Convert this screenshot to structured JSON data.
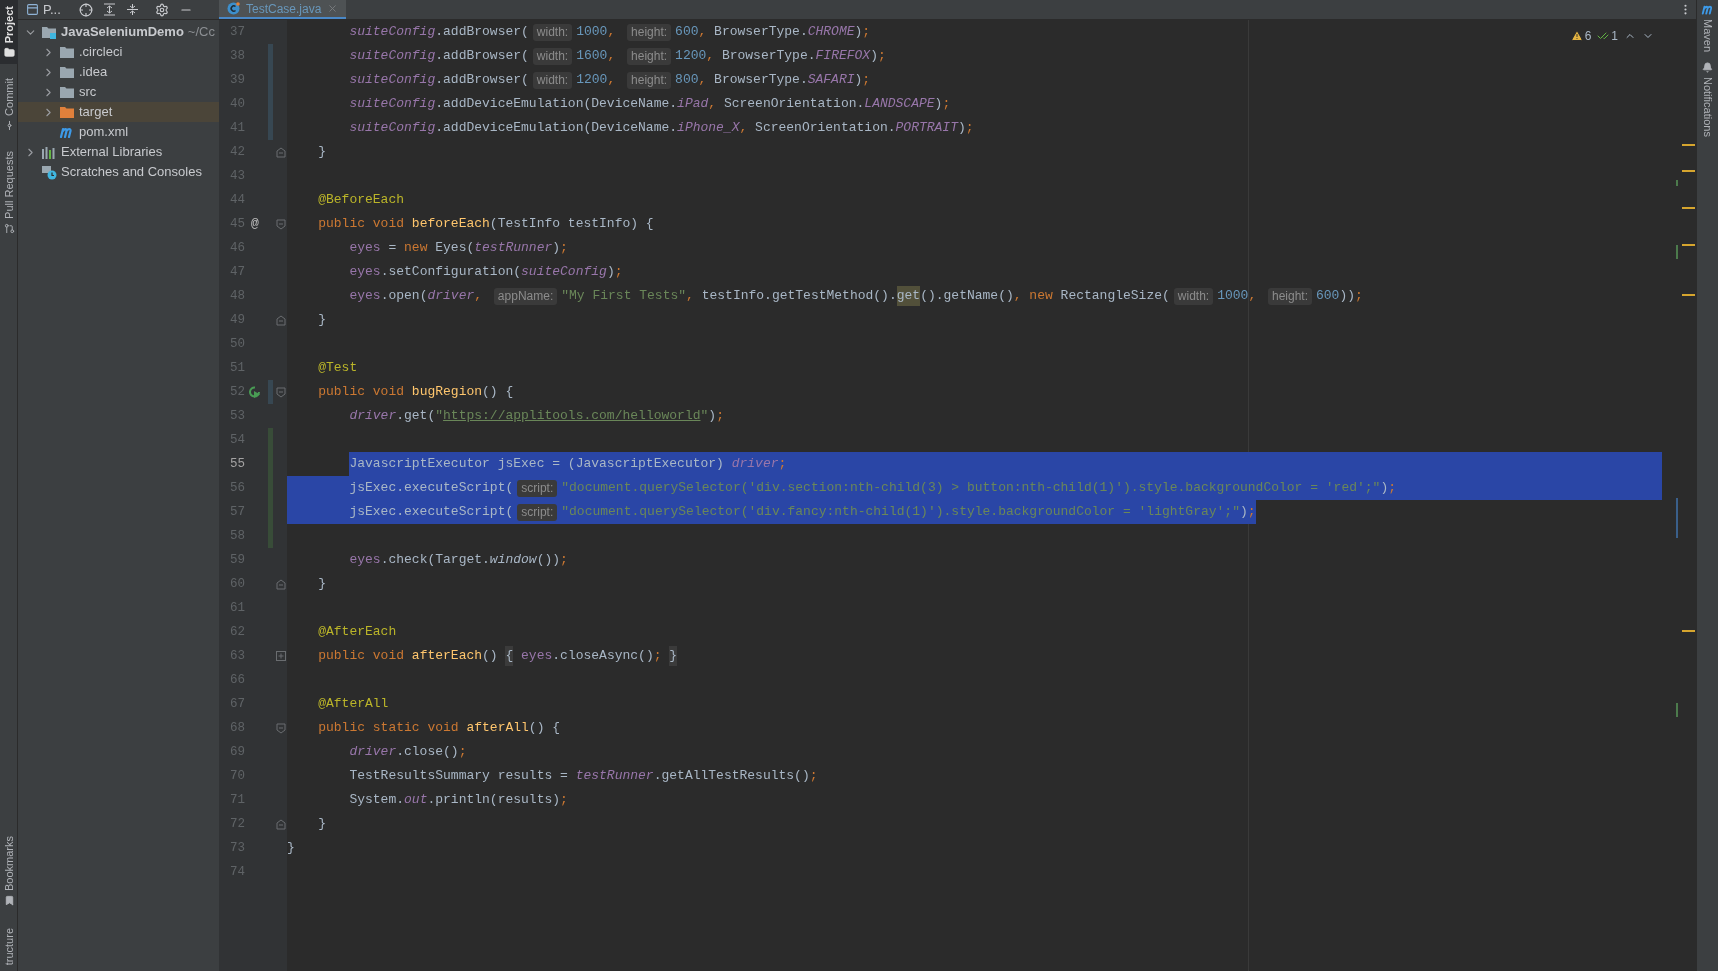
{
  "left_toolbar": {
    "top": [
      {
        "label": "Project",
        "kind": "folder",
        "selected": true
      },
      {
        "label": "Commit",
        "kind": "commit",
        "selected": false
      },
      {
        "label": "Pull Requests",
        "kind": "pull",
        "selected": false
      }
    ],
    "bottom": [
      {
        "label": "Bookmarks",
        "kind": "bookmark",
        "selected": false
      },
      {
        "label": "tructure",
        "kind": "plain",
        "selected": false
      }
    ]
  },
  "project_toolbar": {
    "label": "P..."
  },
  "tabs": [
    {
      "label": "TestCase.java",
      "selected": true
    }
  ],
  "project_tree": [
    {
      "label": "JavaSeleniumDemo",
      "suffix": "~/Cc",
      "kind": "module",
      "expanded": true,
      "selected": false,
      "children": [
        {
          "label": ".circleci",
          "kind": "folder",
          "expanded": false,
          "selected": false
        },
        {
          "label": ".idea",
          "kind": "folder",
          "expanded": false,
          "selected": false
        },
        {
          "label": "src",
          "kind": "folder",
          "expanded": false,
          "selected": false
        },
        {
          "label": "target",
          "kind": "excluded",
          "expanded": false,
          "selected": true
        },
        {
          "label": "pom.xml",
          "kind": "maven",
          "selected": false
        }
      ]
    },
    {
      "label": "External Libraries",
      "kind": "libraries",
      "expanded": false,
      "selected": false
    },
    {
      "label": "Scratches and Consoles",
      "kind": "scratches",
      "selected": false
    }
  ],
  "inspections": {
    "warnings": "6",
    "checks": "1"
  },
  "right_toolbar": [
    {
      "label": "Maven",
      "kind": "maven"
    },
    {
      "label": "Notifications",
      "kind": "bell"
    }
  ],
  "editor": {
    "lines": [
      {
        "number": "37",
        "current": false,
        "tokens": [
          {
            "kind": "field",
            "text": "        suiteConfig"
          },
          {
            "kind": "plain",
            "text": ".addBrowser("
          },
          {
            "kind": "hint",
            "text": "width:"
          },
          {
            "kind": "num",
            "text": "1000"
          },
          {
            "kind": "punct",
            "text": ", "
          },
          {
            "kind": "hint",
            "text": "height:"
          },
          {
            "kind": "num",
            "text": "600"
          },
          {
            "kind": "punct",
            "text": ", "
          },
          {
            "kind": "plain",
            "text": "BrowserType."
          },
          {
            "kind": "field",
            "text": "CHROME"
          },
          {
            "kind": "plain",
            "text": ")"
          },
          {
            "kind": "punct",
            "text": ";"
          }
        ]
      },
      {
        "number": "38",
        "current": false,
        "change": {
          "kind": "modified"
        },
        "tokens": [
          {
            "kind": "field",
            "text": "        suiteConfig"
          },
          {
            "kind": "plain",
            "text": ".addBrowser("
          },
          {
            "kind": "hint",
            "text": "width:"
          },
          {
            "kind": "num",
            "text": "1600"
          },
          {
            "kind": "punct",
            "text": ", "
          },
          {
            "kind": "hint",
            "text": "height:"
          },
          {
            "kind": "num",
            "text": "1200"
          },
          {
            "kind": "punct",
            "text": ", "
          },
          {
            "kind": "plain",
            "text": "BrowserType."
          },
          {
            "kind": "field",
            "text": "FIREFOX"
          },
          {
            "kind": "plain",
            "text": ")"
          },
          {
            "kind": "punct",
            "text": ";"
          }
        ]
      },
      {
        "number": "39",
        "current": false,
        "change": {
          "kind": "modified"
        },
        "tokens": [
          {
            "kind": "field",
            "text": "        suiteConfig"
          },
          {
            "kind": "plain",
            "text": ".addBrowser("
          },
          {
            "kind": "hint",
            "text": "width:"
          },
          {
            "kind": "num",
            "text": "1200"
          },
          {
            "kind": "punct",
            "text": ", "
          },
          {
            "kind": "hint",
            "text": "height:"
          },
          {
            "kind": "num",
            "text": "800"
          },
          {
            "kind": "punct",
            "text": ", "
          },
          {
            "kind": "plain",
            "text": "BrowserType."
          },
          {
            "kind": "field",
            "text": "SAFARI"
          },
          {
            "kind": "plain",
            "text": ")"
          },
          {
            "kind": "punct",
            "text": ";"
          }
        ]
      },
      {
        "number": "40",
        "current": false,
        "change": {
          "kind": "modified"
        },
        "tokens": [
          {
            "kind": "field",
            "text": "        suiteConfig"
          },
          {
            "kind": "plain",
            "text": ".addDeviceEmulation(DeviceName."
          },
          {
            "kind": "field",
            "text": "iPad"
          },
          {
            "kind": "punct",
            "text": ", "
          },
          {
            "kind": "plain",
            "text": "ScreenOrientation."
          },
          {
            "kind": "field",
            "text": "LANDSCAPE"
          },
          {
            "kind": "plain",
            "text": ")"
          },
          {
            "kind": "punct",
            "text": ";"
          }
        ]
      },
      {
        "number": "41",
        "current": false,
        "change": {
          "kind": "modified"
        },
        "tokens": [
          {
            "kind": "field",
            "text": "        suiteConfig"
          },
          {
            "kind": "plain",
            "text": ".addDeviceEmulation(DeviceName."
          },
          {
            "kind": "field",
            "text": "iPhone_X"
          },
          {
            "kind": "punct",
            "text": ", "
          },
          {
            "kind": "plain",
            "text": "ScreenOrientation."
          },
          {
            "kind": "field",
            "text": "PORTRAIT"
          },
          {
            "kind": "plain",
            "text": ")"
          },
          {
            "kind": "punct",
            "text": ";"
          }
        ]
      },
      {
        "number": "42",
        "current": false,
        "fold": {
          "kind": "end"
        },
        "tokens": [
          {
            "kind": "plain",
            "text": "    }"
          }
        ]
      },
      {
        "number": "43",
        "current": false
      },
      {
        "number": "44",
        "current": false,
        "tokens": [
          {
            "kind": "ann",
            "text": "    @BeforeEach"
          }
        ]
      },
      {
        "number": "45",
        "current": false,
        "fold": {
          "kind": "start"
        },
        "gutter": {
          "kind": "text",
          "text": "@"
        },
        "tokens": [
          {
            "kind": "kw",
            "text": "    public void "
          },
          {
            "kind": "fn",
            "text": "beforeEach"
          },
          {
            "kind": "plain",
            "text": "(TestInfo testInfo) {"
          }
        ]
      },
      {
        "number": "46",
        "current": false,
        "tokens": [
          {
            "kind": "member",
            "text": "        eyes"
          },
          {
            "kind": "plain",
            "text": " = "
          },
          {
            "kind": "kw",
            "text": "new "
          },
          {
            "kind": "plain",
            "text": "Eyes("
          },
          {
            "kind": "field",
            "text": "testRunner"
          },
          {
            "kind": "plain",
            "text": ")"
          },
          {
            "kind": "punct",
            "text": ";"
          }
        ]
      },
      {
        "number": "47",
        "current": false,
        "tokens": [
          {
            "kind": "member",
            "text": "        eyes"
          },
          {
            "kind": "plain",
            "text": ".setConfiguration("
          },
          {
            "kind": "field",
            "text": "suiteConfig"
          },
          {
            "kind": "plain",
            "text": ")"
          },
          {
            "kind": "punct",
            "text": ";"
          }
        ]
      },
      {
        "number": "48",
        "current": false,
        "tokens": [
          {
            "kind": "member",
            "text": "        eyes"
          },
          {
            "kind": "plain",
            "text": ".open("
          },
          {
            "kind": "field",
            "text": "driver"
          },
          {
            "kind": "punct",
            "text": ", "
          },
          {
            "kind": "hint",
            "text": "appName:"
          },
          {
            "kind": "str",
            "text": "\"My First Tests\""
          },
          {
            "kind": "punct",
            "text": ", "
          },
          {
            "kind": "plain",
            "text": "testInfo.getTestMethod()."
          },
          {
            "kind": "match",
            "text": "get"
          },
          {
            "kind": "plain",
            "text": "().getName()"
          },
          {
            "kind": "punct",
            "text": ", "
          },
          {
            "kind": "kw",
            "text": "new "
          },
          {
            "kind": "plain",
            "text": "RectangleSize("
          },
          {
            "kind": "hint",
            "text": "width:"
          },
          {
            "kind": "num",
            "text": "1000"
          },
          {
            "kind": "punct",
            "text": ", "
          },
          {
            "kind": "hint",
            "text": "height:"
          },
          {
            "kind": "num",
            "text": "600"
          },
          {
            "kind": "plain",
            "text": "))"
          },
          {
            "kind": "punct",
            "text": ";"
          }
        ]
      },
      {
        "number": "49",
        "current": false,
        "fold": {
          "kind": "end"
        },
        "tokens": [
          {
            "kind": "plain",
            "text": "    }"
          }
        ]
      },
      {
        "number": "50",
        "current": false
      },
      {
        "number": "51",
        "current": false,
        "tokens": [
          {
            "kind": "ann",
            "text": "    @Test"
          }
        ]
      },
      {
        "number": "52",
        "current": false,
        "fold": {
          "kind": "start"
        },
        "change": {
          "kind": "modified"
        },
        "gutter": {
          "kind": "run"
        },
        "tokens": [
          {
            "kind": "kw",
            "text": "    public void "
          },
          {
            "kind": "fn",
            "text": "bugRegion"
          },
          {
            "kind": "plain",
            "text": "() {"
          }
        ]
      },
      {
        "number": "53",
        "current": false,
        "tokens": [
          {
            "kind": "field",
            "text": "        driver"
          },
          {
            "kind": "plain",
            "text": ".get("
          },
          {
            "kind": "str",
            "text": "\""
          },
          {
            "kind": "url",
            "text": "https://applitools.com/helloworld"
          },
          {
            "kind": "str",
            "text": "\""
          },
          {
            "kind": "plain",
            "text": ")"
          },
          {
            "kind": "punct",
            "text": ";"
          }
        ]
      },
      {
        "number": "54",
        "current": false,
        "change": {
          "kind": "added"
        }
      },
      {
        "number": "55",
        "current": true,
        "change": {
          "kind": "added"
        },
        "selection": {
          "kind": "from_text"
        },
        "tokens": [
          {
            "kind": "plain",
            "text": "        JavascriptExecutor jsExec = (JavascriptExecutor) "
          },
          {
            "kind": "field",
            "text": "driver"
          },
          {
            "kind": "punct",
            "text": ";"
          }
        ]
      },
      {
        "number": "56",
        "current": false,
        "change": {
          "kind": "added"
        },
        "selection": {
          "kind": "full"
        },
        "tokens": [
          {
            "kind": "plain",
            "text": "        jsExec.executeScript("
          },
          {
            "kind": "hint",
            "text": "script:"
          },
          {
            "kind": "str",
            "text": "\"document.querySelector('div.section:nth-child(3) > button:nth-child(1)').style.backgroundColor = 'red';\""
          },
          {
            "kind": "plain",
            "text": ")"
          },
          {
            "kind": "punct",
            "text": ";"
          }
        ]
      },
      {
        "number": "57",
        "current": false,
        "change": {
          "kind": "added"
        },
        "selection": {
          "kind": "to_text"
        },
        "tokens": [
          {
            "kind": "plain",
            "text": "        jsExec.executeScript("
          },
          {
            "kind": "hint",
            "text": "script:"
          },
          {
            "kind": "str",
            "text": "\"document.querySelector('div.fancy:nth-child(1)').style.backgroundColor = 'lightGray';\""
          },
          {
            "kind": "plain",
            "text": ")"
          },
          {
            "kind": "punct",
            "text": ";"
          }
        ]
      },
      {
        "number": "58",
        "current": false,
        "change": {
          "kind": "added"
        }
      },
      {
        "number": "59",
        "current": false,
        "tokens": [
          {
            "kind": "member",
            "text": "        eyes"
          },
          {
            "kind": "plain",
            "text": ".check(Target."
          },
          {
            "kind": "italic",
            "text": "window"
          },
          {
            "kind": "plain",
            "text": "())"
          },
          {
            "kind": "punct",
            "text": ";"
          }
        ]
      },
      {
        "number": "60",
        "current": false,
        "fold": {
          "kind": "end"
        },
        "tokens": [
          {
            "kind": "plain",
            "text": "    }"
          }
        ]
      },
      {
        "number": "61",
        "current": false
      },
      {
        "number": "62",
        "current": false,
        "tokens": [
          {
            "kind": "ann",
            "text": "    @AfterEach"
          }
        ]
      },
      {
        "number": "63",
        "current": false,
        "fold": {
          "kind": "collapsed"
        },
        "tokens": [
          {
            "kind": "kw",
            "text": "    public void "
          },
          {
            "kind": "fn",
            "text": "afterEach"
          },
          {
            "kind": "plain",
            "text": "() "
          },
          {
            "kind": "folded",
            "text": "{"
          },
          {
            "kind": "member",
            "text": " eyes"
          },
          {
            "kind": "plain",
            "text": ".closeAsync()"
          },
          {
            "kind": "punct",
            "text": "; "
          },
          {
            "kind": "folded",
            "text": "}"
          }
        ]
      },
      {
        "number": "66",
        "current": false
      },
      {
        "number": "67",
        "current": false,
        "tokens": [
          {
            "kind": "ann",
            "text": "    @AfterAll"
          }
        ]
      },
      {
        "number": "68",
        "current": false,
        "fold": {
          "kind": "start"
        },
        "tokens": [
          {
            "kind": "kw",
            "text": "    public static void "
          },
          {
            "kind": "fn",
            "text": "afterAll"
          },
          {
            "kind": "plain",
            "text": "() {"
          }
        ]
      },
      {
        "number": "69",
        "current": false,
        "tokens": [
          {
            "kind": "field",
            "text": "        driver"
          },
          {
            "kind": "plain",
            "text": ".close()"
          },
          {
            "kind": "punct",
            "text": ";"
          }
        ]
      },
      {
        "number": "70",
        "current": false,
        "tokens": [
          {
            "kind": "plain",
            "text": "        TestResultsSummary results = "
          },
          {
            "kind": "field",
            "text": "testRunner"
          },
          {
            "kind": "plain",
            "text": ".getAllTestResults()"
          },
          {
            "kind": "punct",
            "text": ";"
          }
        ]
      },
      {
        "number": "71",
        "current": false,
        "tokens": [
          {
            "kind": "plain",
            "text": "        System."
          },
          {
            "kind": "field",
            "text": "out"
          },
          {
            "kind": "plain",
            "text": ".println(results)"
          },
          {
            "kind": "punct",
            "text": ";"
          }
        ]
      },
      {
        "number": "72",
        "current": false,
        "fold": {
          "kind": "end"
        },
        "tokens": [
          {
            "kind": "plain",
            "text": "    }"
          }
        ]
      },
      {
        "number": "73",
        "current": false,
        "tokens": [
          {
            "kind": "plain",
            "text": "}"
          }
        ]
      },
      {
        "number": "74",
        "current": false
      }
    ]
  }
}
